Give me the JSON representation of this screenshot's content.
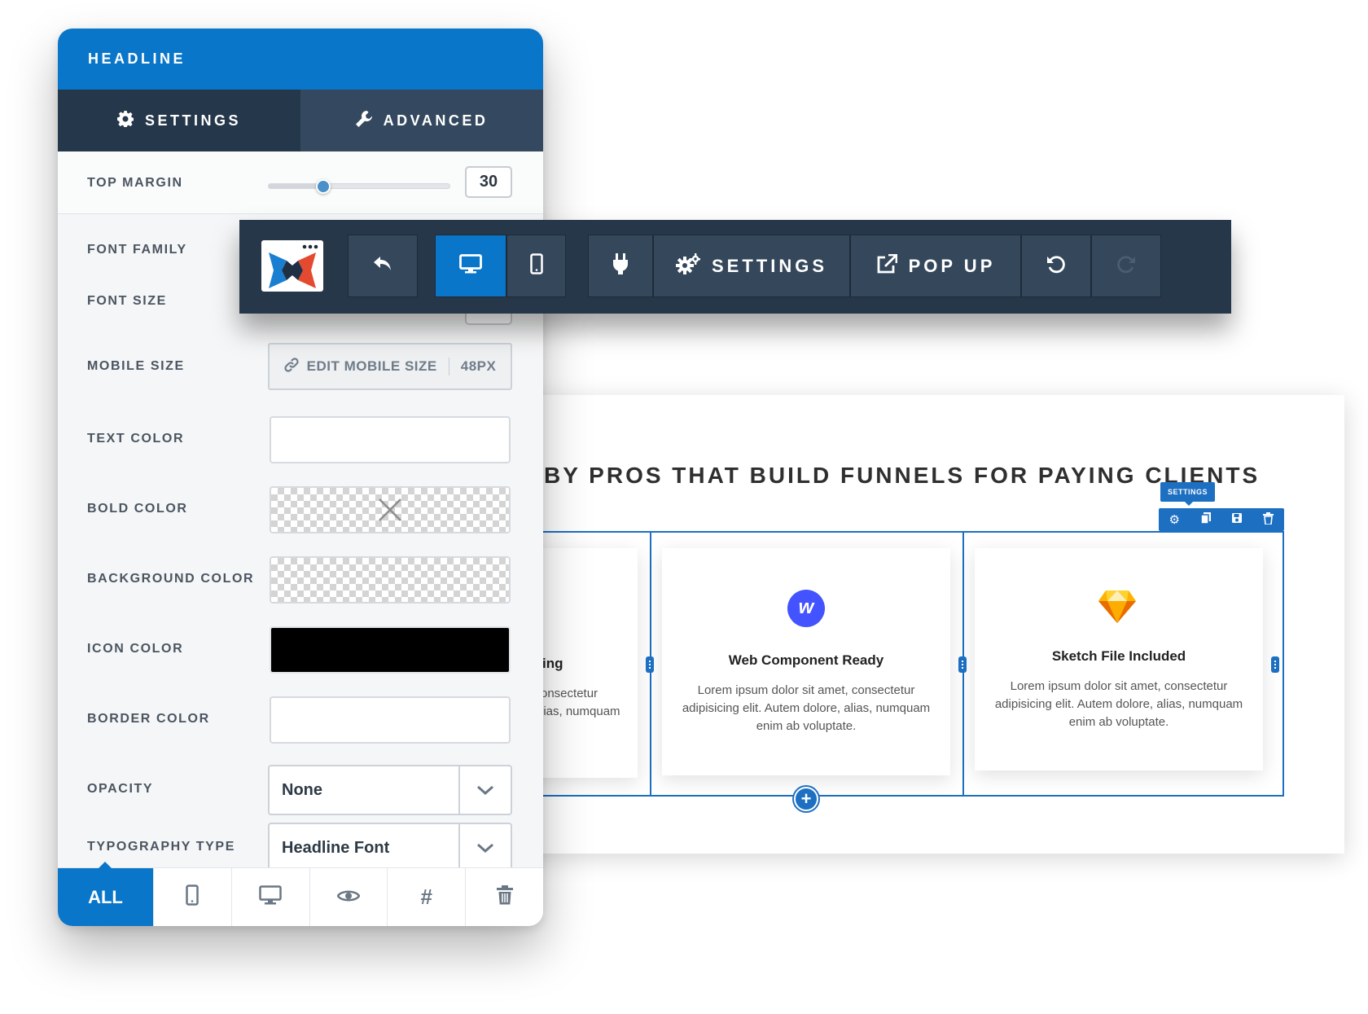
{
  "panel": {
    "title": "HEADLINE",
    "tabs": [
      {
        "label": "SETTINGS",
        "icon": "gear-icon",
        "active": true
      },
      {
        "label": "ADVANCED",
        "icon": "wrench-icon",
        "active": false
      }
    ],
    "top_margin": {
      "label": "TOP MARGIN",
      "value": "30",
      "slider_fraction": 0.3
    },
    "font_family": {
      "label": "FONT FAMILY"
    },
    "font_size": {
      "label": "FONT SIZE"
    },
    "mobile_size": {
      "label": "MOBILE SIZE",
      "button_label": "EDIT MOBILE SIZE",
      "value": "48PX"
    },
    "text_color": {
      "label": "TEXT COLOR",
      "color": "#ffffff"
    },
    "bold_color": {
      "label": "BOLD COLOR",
      "color": "transparent"
    },
    "background_color": {
      "label": "BACKGROUND COLOR",
      "color": "transparent"
    },
    "icon_color": {
      "label": "ICON COLOR",
      "color": "#000000"
    },
    "border_color": {
      "label": "BORDER COLOR",
      "color": "#ffffff"
    },
    "opacity": {
      "label": "OPACITY",
      "value": "None"
    },
    "typography_type": {
      "label": "TYPOGRAPHY TYPE",
      "value": "Headline Font"
    },
    "bottom_bar": {
      "all_label": "ALL",
      "icons": [
        "mobile-icon",
        "desktop-icon",
        "eye-icon",
        "hash-icon",
        "trash-icon"
      ]
    }
  },
  "toolbar": {
    "settings_label": "SETTINGS",
    "popup_label": "POP UP",
    "icons": [
      "logo",
      "undo-arrow-icon",
      "desktop-icon",
      "mobile-icon",
      "plug-icon",
      "gears-icon",
      "external-link-icon",
      "undo-icon",
      "redo-icon"
    ],
    "active_view": "desktop"
  },
  "page": {
    "headline": "BY PROS THAT BUILD FUNNELS FOR PAYING CLIENTS",
    "settings_tooltip": "SETTINGS",
    "cards": [
      {
        "title": "ing",
        "text_line1": "onsectetur",
        "text_line2": "lias, numquam",
        "text_line3": "."
      },
      {
        "title": "Web Component Ready",
        "icon": "webflow-icon",
        "icon_letter": "w",
        "text_line1": "Lorem ipsum dolor sit amet, consectetur",
        "text_line2": "adipisicing elit. Autem dolore, alias, numquam",
        "text_line3": "enim ab voluptate."
      },
      {
        "title": "Sketch File Included",
        "icon": "sketch-icon",
        "text_line1": "Lorem ipsum dolor sit amet, consectetur",
        "text_line2": "adipisicing elit. Autem dolore, alias, numquam",
        "text_line3": "enim ab voluptate."
      }
    ],
    "accent_color": "#1d6fc2"
  }
}
